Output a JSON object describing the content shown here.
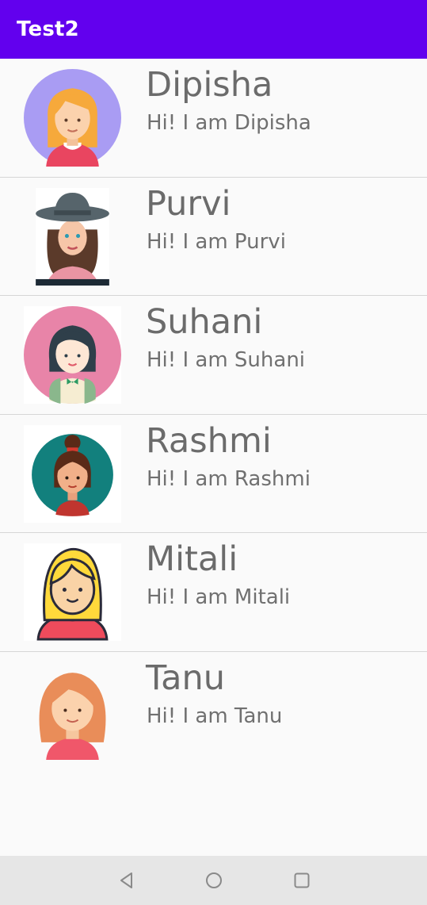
{
  "appbar": {
    "title": "Test2",
    "color": "#6200ee"
  },
  "contacts": [
    {
      "name": "Dipisha",
      "greeting": "Hi! I am Dipisha",
      "avatar_icon": "girl-avatar-blonde-icon"
    },
    {
      "name": "Purvi",
      "greeting": "Hi! I am Purvi",
      "avatar_icon": "girl-avatar-hat-icon"
    },
    {
      "name": "Suhani",
      "greeting": "Hi! I am Suhani",
      "avatar_icon": "girl-avatar-bob-icon"
    },
    {
      "name": "Rashmi",
      "greeting": "Hi! I am Rashmi",
      "avatar_icon": "girl-avatar-bun-icon"
    },
    {
      "name": "Mitali",
      "greeting": "Hi! I am Mitali",
      "avatar_icon": "girl-avatar-yellow-hair-icon"
    },
    {
      "name": "Tanu",
      "greeting": "Hi! I am Tanu",
      "avatar_icon": "girl-avatar-ginger-icon"
    }
  ],
  "navbar": {
    "back_icon": "back-triangle-icon",
    "home_icon": "home-circle-icon",
    "recents_icon": "recents-square-icon"
  }
}
